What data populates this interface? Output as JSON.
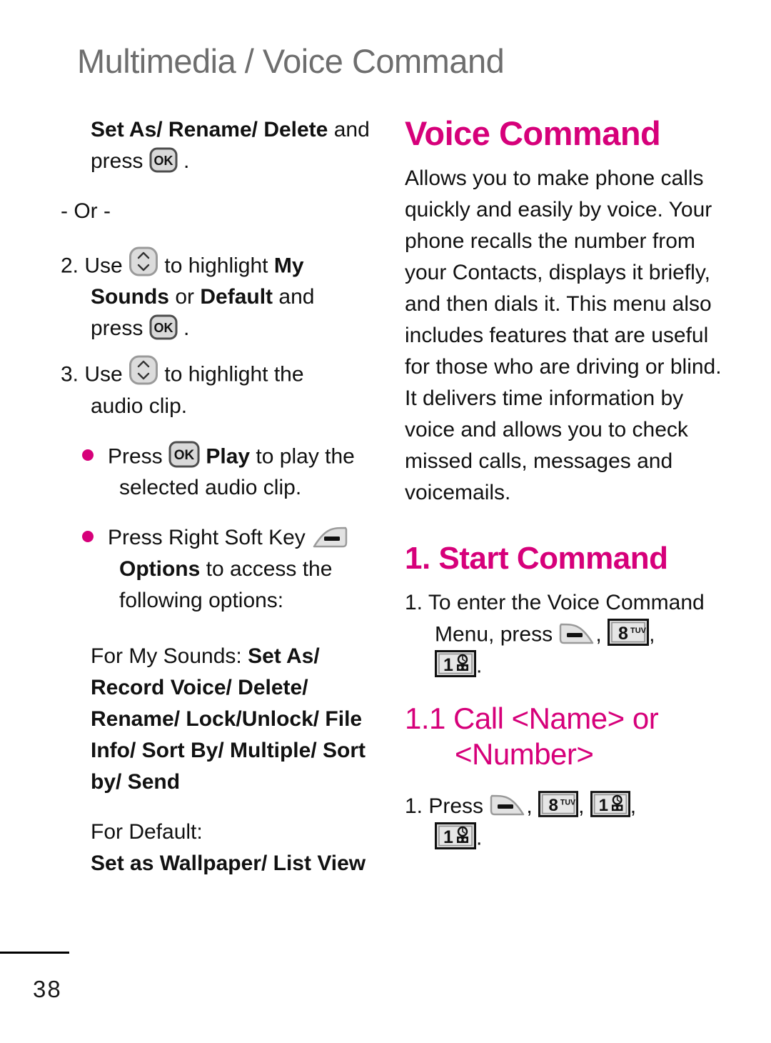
{
  "page": {
    "header": "Multimedia / Voice Command",
    "number": "38",
    "accent_color": "#d6007a",
    "header_color": "#6e6e6e"
  },
  "left_column": {
    "step1_cont": {
      "bold_lead": "Set As/ Rename/ Delete",
      "after_bold": " and",
      "line2_pre": "press",
      "line2_post": "."
    },
    "or_divider": "- Or -",
    "step2": {
      "num": "2. Use",
      "mid": "to highlight",
      "bold_a": "My",
      "bold_b": "Sounds",
      "conj": " or ",
      "bold_c": "Default",
      "after": " and",
      "press": "press",
      "period": "."
    },
    "step3": {
      "num": "3. Use",
      "mid": "to highlight the",
      "line2": "audio clip."
    },
    "bullet_play": {
      "pre": "Press",
      "bold": "Play",
      "post": " to play the",
      "line2": "selected audio clip."
    },
    "bullet_options": {
      "pre": "Press Right Soft Key",
      "bold": "Options",
      "post": " to access the",
      "line2": "following options:"
    },
    "for_my_sounds": {
      "label": "For My Sounds: ",
      "options": "Set As/ Record Voice/ Delete/ Rename/ Lock/Unlock/ File Info/ Sort By/ Multiple/ Sort by/ Send"
    },
    "for_default": {
      "label": "For Default:",
      "options": "Set as Wallpaper/ List View"
    }
  },
  "right_column": {
    "title": "Voice Command",
    "description": "Allows you to make phone calls quickly and easily by voice. Your phone recalls the number from your Contacts, displays it briefly, and then dials it. This menu also includes features that are useful for those who are driving or blind. It delivers time information by voice and allows you to check missed calls, messages and voicemails.",
    "section1": {
      "heading": "1. Start Command",
      "step1_line1": "1. To enter the Voice Command",
      "step1_line2": "Menu, press",
      "comma": ",",
      "period": "."
    },
    "section11": {
      "heading_line1": "1.1 Call <Name> or",
      "heading_line2": "<Number>",
      "step1": "1. Press",
      "comma": ",",
      "period": "."
    }
  },
  "icons": {
    "ok_key": "ok-key-icon",
    "nav_key": "navigation-updown-key-icon",
    "right_soft_key": "right-soft-key-icon",
    "left_soft_key": "left-soft-key-icon",
    "key_8": "keypad-8-tuv-icon",
    "key_1": "keypad-1-voicemail-icon",
    "ok_label": "OK",
    "key_8_digit": "8",
    "key_8_letters": "TUV",
    "key_1_digit": "1"
  }
}
